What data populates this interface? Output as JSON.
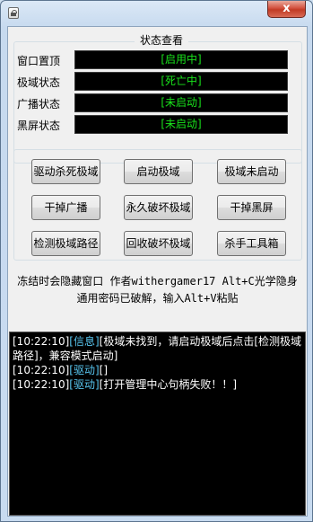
{
  "window": {
    "close_label": "x"
  },
  "status": {
    "title": "状态查看",
    "rows": [
      {
        "label": "窗口置顶",
        "value": "[启用中]"
      },
      {
        "label": "极域状态",
        "value": "[死亡中]"
      },
      {
        "label": "广播状态",
        "value": "[未启动]"
      },
      {
        "label": "黑屏状态",
        "value": "[未启动]"
      }
    ]
  },
  "actions": {
    "buttons": [
      "驱动杀死极域",
      "启动极域",
      "极域未启动",
      "干掉广播",
      "永久破坏极域",
      "干掉黑屏",
      "检测极域路径",
      "回收破坏极域",
      "杀手工具箱"
    ]
  },
  "info": {
    "line1": "冻结时会隐藏窗口 作者withergamer17 Alt+C光学隐身",
    "line2": "通用密码已破解，输入Alt+V粘贴"
  },
  "log": {
    "lines": [
      {
        "time": "[10:22:10]",
        "tag": "[信息]",
        "text": "[极域未找到，请启动极域后点击[检测极域路径]，兼容模式启动]"
      },
      {
        "time": "[10:22:10]",
        "tag": "[驱动]",
        "text": "[]"
      },
      {
        "time": "[10:22:10]",
        "tag": "[驱动]",
        "text": "[打开管理中心句柄失败！！]"
      }
    ]
  },
  "colors": {
    "status_text": "#19e21b",
    "log_tag": "#58c6f0",
    "close_button": "#c13a25"
  },
  "icons": {
    "app": "lock-icon",
    "close": "close-icon"
  }
}
